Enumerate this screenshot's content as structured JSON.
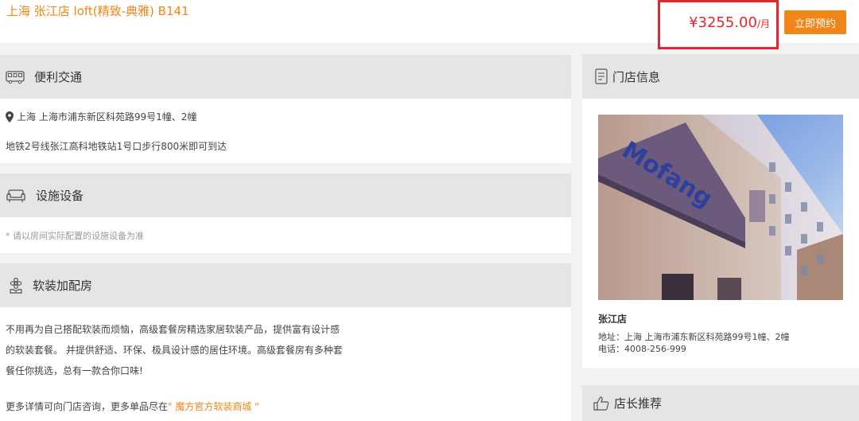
{
  "header": {
    "title": "上海 张江店 loft(精致-典雅) B141",
    "price": "¥3255.00",
    "price_unit": "/月",
    "book_label": "立即预约"
  },
  "transport": {
    "heading": "便利交通",
    "address": "上海 上海市浦东新区科苑路99号1幢、2幢",
    "directions": "地铁2号线张江高科地铁站1号口步行800米即可到达"
  },
  "facilities": {
    "heading": "设施设备",
    "note": "* 请以房间实际配置的设施设备为准"
  },
  "soft": {
    "heading": "软装加配房",
    "line1": "不用再为自己搭配软装而烦恼，高级套餐房精选家居软装产品，提供富有设计感",
    "line2": "的软装套餐。 并提供舒适、环保、极具设计感的居住环境。高级套餐房有多种套",
    "line3": "餐任你挑选，总有一款合你口味!",
    "more_prefix": "更多详情可向门店咨询，更多单品尽在",
    "more_link": "\" 魔方官方软装商城 \""
  },
  "store": {
    "heading": "门店信息",
    "name": "张江店",
    "address": "地址：上海 上海市浦东新区科苑路99号1幢、2幢",
    "phone": "电话：4008-256-999",
    "sign_text": "Mofang"
  },
  "recommend": {
    "heading": "店长推荐"
  },
  "colors": {
    "accent": "#f08519",
    "price": "#e8232b",
    "highlight_border": "#e8232b"
  },
  "icons": {
    "transport": "bus-icon",
    "facilities": "sofa-icon",
    "soft": "flower-icon",
    "store": "document-icon",
    "recommend": "thumbs-up-icon",
    "location": "location-pin-icon"
  }
}
